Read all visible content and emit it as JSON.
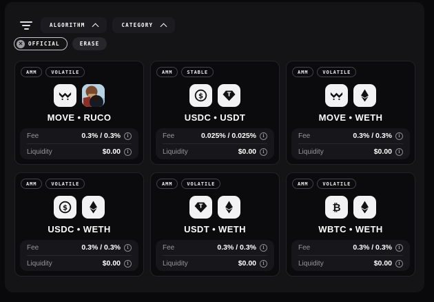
{
  "colors": {
    "outer_bg": "#09090b",
    "panel_bg": "#141417",
    "card_bg": "#0b0b0d",
    "stats_bg": "#17171b",
    "button_bg": "#1c1c20",
    "text_muted": "#96969c",
    "text_white": "#ffffff"
  },
  "icons": {
    "remove_glyph": "✕",
    "info_glyph": "i"
  },
  "toolbar": {
    "filters": [
      {
        "label": "ALGORITHM"
      },
      {
        "label": "CATEGORY"
      }
    ],
    "chips": [
      {
        "label": "OFFICIAL",
        "removable": true
      },
      {
        "label": "ERASE",
        "removable": false
      }
    ]
  },
  "stats_labels": {
    "fee": "Fee",
    "liquidity": "Liquidity"
  },
  "pools": [
    {
      "badges": [
        "AMM",
        "VOLATILE"
      ],
      "tokens": [
        "MOVE",
        "RUCO"
      ],
      "name": "MOVE • RUCO",
      "fee": "0.3% / 0.3%",
      "liquidity": "$0.00"
    },
    {
      "badges": [
        "AMM",
        "STABLE"
      ],
      "tokens": [
        "USDC",
        "USDT"
      ],
      "name": "USDC • USDT",
      "fee": "0.025% / 0.025%",
      "liquidity": "$0.00"
    },
    {
      "badges": [
        "AMM",
        "VOLATILE"
      ],
      "tokens": [
        "MOVE",
        "WETH"
      ],
      "name": "MOVE • WETH",
      "fee": "0.3% / 0.3%",
      "liquidity": "$0.00"
    },
    {
      "badges": [
        "AMM",
        "VOLATILE"
      ],
      "tokens": [
        "USDC",
        "WETH"
      ],
      "name": "USDC • WETH",
      "fee": "0.3% / 0.3%",
      "liquidity": "$0.00"
    },
    {
      "badges": [
        "AMM",
        "VOLATILE"
      ],
      "tokens": [
        "USDT",
        "WETH"
      ],
      "name": "USDT • WETH",
      "fee": "0.3% / 0.3%",
      "liquidity": "$0.00"
    },
    {
      "badges": [
        "AMM",
        "VOLATILE"
      ],
      "tokens": [
        "WBTC",
        "WETH"
      ],
      "name": "WBTC • WETH",
      "fee": "0.3% / 0.3%",
      "liquidity": "$0.00"
    }
  ]
}
